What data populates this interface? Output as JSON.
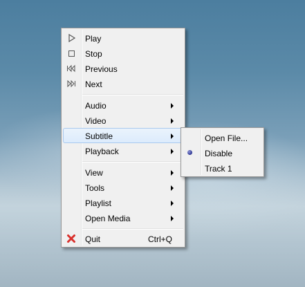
{
  "main_menu": {
    "items": [
      {
        "label": "Play",
        "icon": "play-icon"
      },
      {
        "label": "Stop",
        "icon": "stop-icon"
      },
      {
        "label": "Previous",
        "icon": "previous-icon"
      },
      {
        "label": "Next",
        "icon": "next-icon"
      },
      {
        "label": "Audio",
        "submenu": true
      },
      {
        "label": "Video",
        "submenu": true
      },
      {
        "label": "Subtitle",
        "submenu": true,
        "highlighted": true
      },
      {
        "label": "Playback",
        "submenu": true
      },
      {
        "label": "View",
        "submenu": true
      },
      {
        "label": "Tools",
        "submenu": true
      },
      {
        "label": "Playlist",
        "submenu": true
      },
      {
        "label": "Open Media",
        "submenu": true
      },
      {
        "label": "Quit",
        "shortcut": "Ctrl+Q",
        "icon": "quit-icon"
      }
    ]
  },
  "subtitle_submenu": {
    "items": [
      {
        "label": "Open File..."
      },
      {
        "label": "Disable",
        "selected": true
      },
      {
        "label": "Track 1"
      }
    ]
  },
  "colors": {
    "menu_bg": "#f0f0f0",
    "highlight": "#dcebfc",
    "quit_icon": "#d9302c",
    "radio": "#2e3792"
  }
}
